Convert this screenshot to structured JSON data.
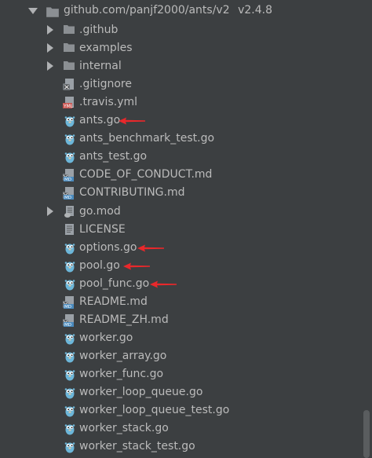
{
  "root": {
    "label": "github.com/panjf2000/ants/v2",
    "version": "v2.4.8"
  },
  "items": [
    {
      "label": ".github",
      "icon": "folder-icon",
      "arrow": true
    },
    {
      "label": "examples",
      "icon": "folder-icon",
      "arrow": true
    },
    {
      "label": "internal",
      "icon": "folder-icon",
      "arrow": true
    },
    {
      "label": ".gitignore",
      "icon": "gitignore-file-icon"
    },
    {
      "label": ".travis.yml",
      "icon": "yaml-file-icon"
    },
    {
      "label": "ants.go",
      "icon": "gopher-icon",
      "marked": true
    },
    {
      "label": "ants_benchmark_test.go",
      "icon": "gopher-icon"
    },
    {
      "label": "ants_test.go",
      "icon": "gopher-icon"
    },
    {
      "label": "CODE_OF_CONDUCT.md",
      "icon": "markdown-file-icon"
    },
    {
      "label": "CONTRIBUTING.md",
      "icon": "markdown-file-icon"
    },
    {
      "label": "go.mod",
      "icon": "go-mod-file-icon",
      "arrow": true
    },
    {
      "label": "LICENSE",
      "icon": "text-file-icon"
    },
    {
      "label": "options.go",
      "icon": "gopher-icon",
      "marked": true
    },
    {
      "label": "pool.go",
      "icon": "gopher-icon",
      "marked": true
    },
    {
      "label": "pool_func.go",
      "icon": "gopher-icon",
      "marked": true
    },
    {
      "label": "README.md",
      "icon": "markdown-file-icon"
    },
    {
      "label": "README_ZH.md",
      "icon": "markdown-file-icon"
    },
    {
      "label": "worker.go",
      "icon": "gopher-icon"
    },
    {
      "label": "worker_array.go",
      "icon": "gopher-icon"
    },
    {
      "label": "worker_func.go",
      "icon": "gopher-icon"
    },
    {
      "label": "worker_loop_queue.go",
      "icon": "gopher-icon"
    },
    {
      "label": "worker_loop_queue_test.go",
      "icon": "gopher-icon"
    },
    {
      "label": "worker_stack.go",
      "icon": "gopher-icon"
    },
    {
      "label": "worker_stack_test.go",
      "icon": "gopher-icon"
    }
  ],
  "colors": {
    "background": "#3c3f41",
    "text": "#bbbbbb",
    "annotation_arrow": "#e8282b",
    "folder": "#8b8f93"
  }
}
